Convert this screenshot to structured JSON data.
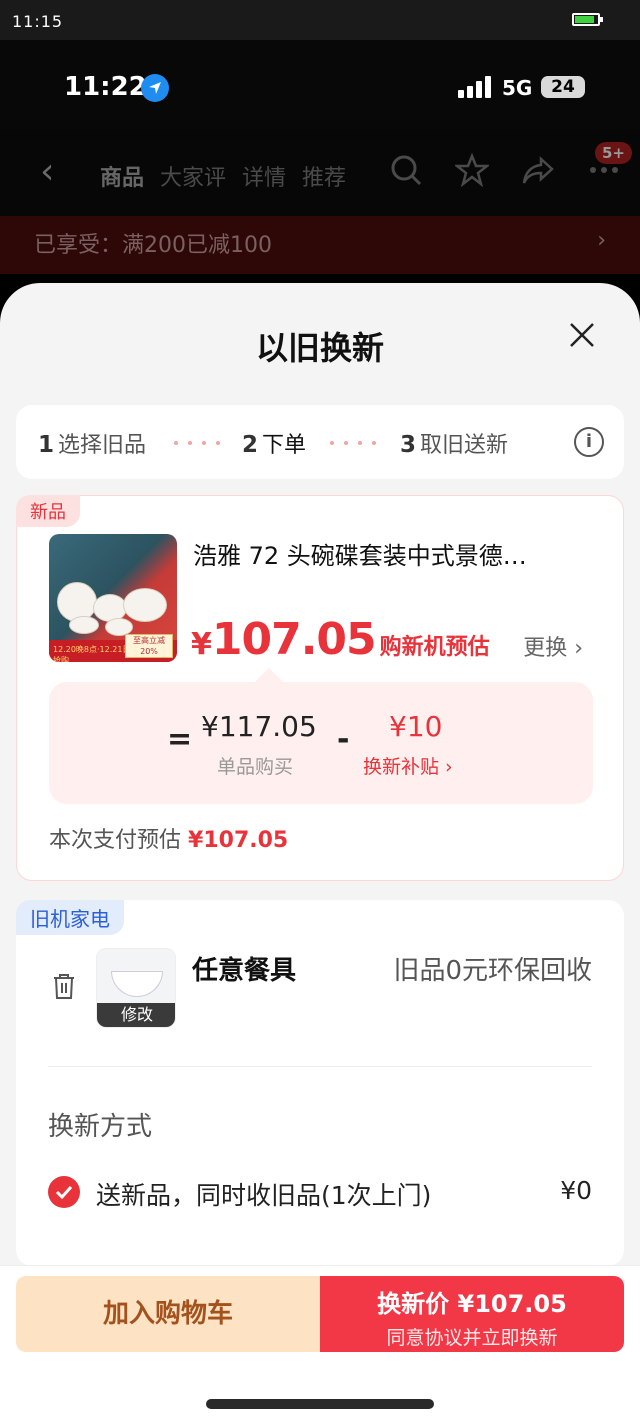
{
  "outer_status": {
    "time": "11:15"
  },
  "ios_status": {
    "time": "11:22",
    "network": "5G",
    "battery": "24"
  },
  "background_page": {
    "tabs": [
      "商品",
      "大家评",
      "详情",
      "推荐"
    ],
    "badge": "5+",
    "promo": "已享受：满200已减100"
  },
  "sheet": {
    "title": "以旧换新",
    "steps": [
      {
        "num": "1",
        "label": "选择旧品"
      },
      {
        "num": "2",
        "label": "下单"
      },
      {
        "num": "3",
        "label": "取旧送新"
      }
    ],
    "info_icon": "i"
  },
  "new_item": {
    "tag": "新品",
    "title": "浩雅 72 头碗碟套装中式景德…",
    "image_banner": "12.20晚8点·12.21日 新鲜品限时抢购",
    "image_stamp": "至高立减 20%",
    "price_symbol": "¥",
    "price": "107.05",
    "price_label": "购新机预估",
    "change": "更换",
    "calc": {
      "equals": "=",
      "unit_price": "¥117.05",
      "unit_label": "单品购买",
      "minus": "-",
      "subsidy": "¥10",
      "subsidy_label": "换新补贴 ›"
    },
    "estimate_label": "本次支付预估",
    "estimate_value": "¥107.05"
  },
  "old_item": {
    "tag": "旧机家电",
    "modify": "修改",
    "name": "任意餐具",
    "desc": "旧品0元环保回收",
    "method_title": "换新方式",
    "method_text": "送新品，同时收旧品(1次上门)",
    "method_price": "¥0"
  },
  "bottom": {
    "add_cart": "加入购物车",
    "buy_main": "换新价 ¥107.05",
    "buy_sub": "同意协议并立即换新"
  },
  "colors": {
    "accent": "#e8333a",
    "cart_bg": "#fde3c4",
    "buy_bg": "#f23846"
  }
}
